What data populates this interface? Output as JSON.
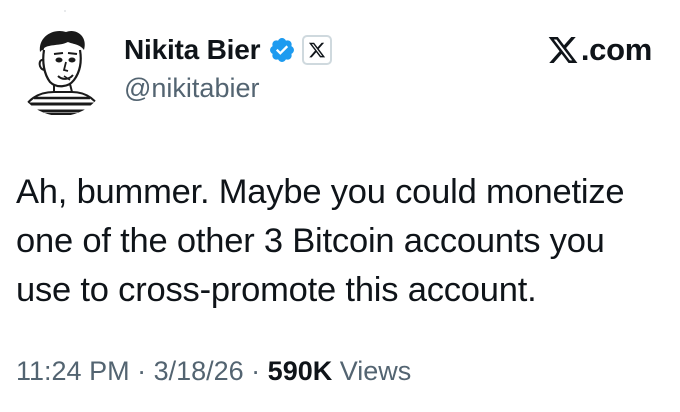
{
  "author": {
    "display_name": "Nikita Bier",
    "handle": "@nikitabier",
    "verified_color": "#1d9bf0",
    "verified_icon": "verified-badge-icon",
    "affiliation_icon": "x-logo-icon"
  },
  "site": {
    "brand_icon": "x-logo-icon",
    "domain_suffix": ".com"
  },
  "post": {
    "text": "Ah, bummer. Maybe you could monetize one of the other 3 Bitcoin accounts you use to cross-promote this account."
  },
  "meta": {
    "time": "11:24 PM",
    "separator": " · ",
    "date": "3/18/26",
    "views_count": "590K",
    "views_label": " Views"
  },
  "colors": {
    "text_primary": "#0f1419",
    "text_secondary": "#536471"
  }
}
